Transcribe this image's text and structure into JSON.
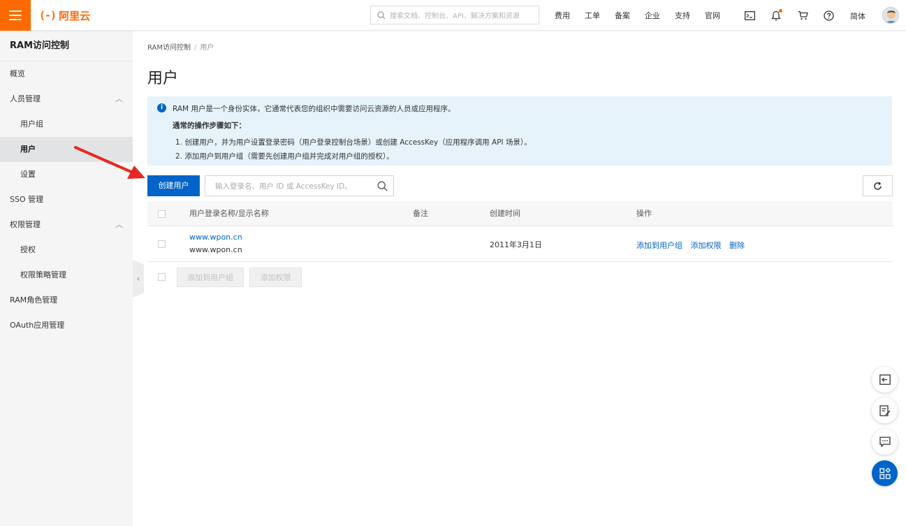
{
  "header": {
    "logo_mark": "(-)",
    "logo_text": "阿里云",
    "search_placeholder": "搜索文档、控制台、API、解决方案和资源",
    "nav": [
      "费用",
      "工单",
      "备案",
      "企业",
      "支持",
      "官网"
    ],
    "language": "简体"
  },
  "sidebar": {
    "title": "RAM访问控制",
    "items": [
      {
        "label": "概览"
      },
      {
        "label": "人员管理"
      },
      {
        "label": "用户组"
      },
      {
        "label": "用户"
      },
      {
        "label": "设置"
      },
      {
        "label": "SSO 管理"
      },
      {
        "label": "权限管理"
      },
      {
        "label": "授权"
      },
      {
        "label": "权限策略管理"
      },
      {
        "label": "RAM角色管理"
      },
      {
        "label": "OAuth应用管理"
      }
    ]
  },
  "breadcrumb": {
    "root": "RAM访问控制",
    "sep": "/",
    "current": "用户"
  },
  "page_title": "用户",
  "notice": {
    "line1": "RAM 用户是一个身份实体，它通常代表您的组织中需要访问云资源的人员或应用程序。",
    "line2": "通常的操作步骤如下：",
    "line3": "1.  创建用户，并为用户设置登录密码（用户登录控制台场景）或创建 AccessKey（应用程序调用 API 场景）。",
    "line4": "2.  添加用户到用户组（需要先创建用户组并完成对用户组的授权）。"
  },
  "toolbar": {
    "create_button": "创建用户",
    "search_placeholder": "输入登录名、用户 ID 或 AccessKey ID。"
  },
  "table": {
    "headers": {
      "name": "用户登录名称/显示名称",
      "note": "备注",
      "created": "创建时间",
      "actions": "操作"
    },
    "rows": [
      {
        "login_name": "www.wpon.cn",
        "display_name": "www.wpon.cn",
        "note": "",
        "created": "2011年3月1日",
        "actions": {
          "add_to_group": "添加到用户组",
          "add_permission": "添加权限",
          "delete": "删除"
        }
      }
    ],
    "footer": {
      "add_to_group": "添加到用户组",
      "add_permission": "添加权限"
    }
  },
  "colors": {
    "brand": "#ff6a00",
    "primary": "#0064c8",
    "notice_bg": "#e6f3fb",
    "annotation_arrow": "#e8281f"
  }
}
